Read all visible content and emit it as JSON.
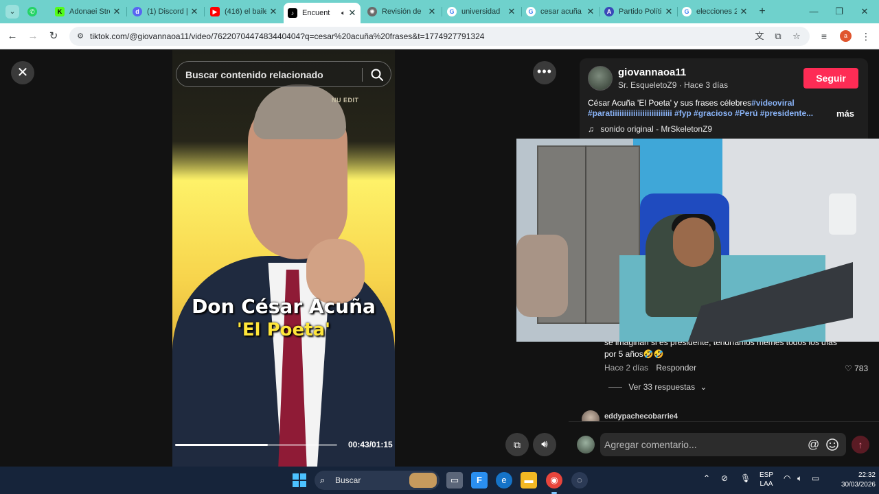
{
  "browser": {
    "tabs": [
      {
        "title": "",
        "favicon": "whatsapp-icon",
        "color": "#25d366"
      },
      {
        "title": "Adonaei Stre",
        "favicon": "kick-icon",
        "color": "#53fc18"
      },
      {
        "title": "(1) Discord |",
        "favicon": "discord-icon",
        "color": "#5865f2"
      },
      {
        "title": "(416) el baile",
        "favicon": "youtube-icon",
        "color": "#ff0000"
      },
      {
        "title": "Encuent",
        "favicon": "tiktok-icon",
        "color": "#000000",
        "active": true
      },
      {
        "title": "Revisión de",
        "favicon": "openai-icon",
        "color": "#6b6b6b"
      },
      {
        "title": "universidad",
        "favicon": "google-icon",
        "color": "#ffffff"
      },
      {
        "title": "cesar acuña",
        "favicon": "google-icon",
        "color": "#ffffff"
      },
      {
        "title": "Partido Políti",
        "favicon": "party-icon",
        "color": "#3a48b8"
      },
      {
        "title": "elecciones 2",
        "favicon": "google-icon",
        "color": "#ffffff"
      }
    ],
    "url": "tiktok.com/@giovannaoa11/video/7622070447483440404?q=cesar%20acuña%20frases&t=1774927791324",
    "profile_initial": "a"
  },
  "video": {
    "search_placeholder": "Buscar contenido relacionado",
    "brand_watermark": "NU EDIT",
    "caption_line1": "Don César Acuña",
    "caption_line2": "'El Poeta'",
    "time": "00:43/01:15",
    "progress": 0.57
  },
  "post": {
    "author": "giovannaoa11",
    "author_sub": "Sr. EsqueletoZ9 · Hace 3 días",
    "follow_label": "Seguir",
    "desc_text": "César Acuña 'El Poeta' y sus frases célebres",
    "desc_tag1": "#videoviral",
    "desc_hashtags": "#paratiiiiiiiiiiiiiiiiiiiiiiiiii #fyp #gracioso #Perú #presidente...",
    "more_label": "más",
    "music": "sonido original - MrSkeletonZ9"
  },
  "comments": {
    "text": "se imaginan si es presidente, tendríamos memes todos los días por 5 años🤣🤣",
    "age": "Hace 2 días",
    "reply_label": "Responder",
    "likes": "783",
    "view_replies": "Ver 33 respuestas",
    "next_author": "eddypachecobarrie4",
    "input_placeholder": "Agregar comentario..."
  },
  "taskbar": {
    "search_label": "Buscar",
    "lang_line1": "ESP",
    "lang_line2": "LAA",
    "time": "22:32",
    "date": "30/03/2026"
  }
}
